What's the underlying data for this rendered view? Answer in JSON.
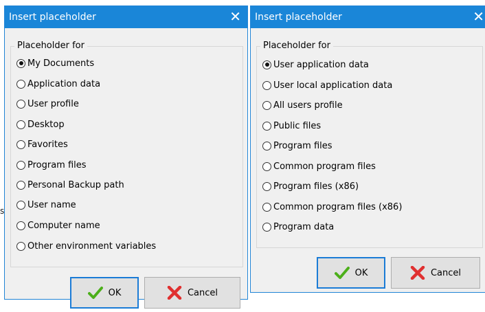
{
  "stray_text": "s",
  "dialog_a": {
    "title": "Insert placeholder",
    "close_glyph": "✕",
    "group_label": "Placeholder for",
    "options": [
      {
        "label": "My Documents",
        "checked": true
      },
      {
        "label": "Application data",
        "checked": false
      },
      {
        "label": "User profile",
        "checked": false
      },
      {
        "label": "Desktop",
        "checked": false
      },
      {
        "label": "Favorites",
        "checked": false
      },
      {
        "label": "Program files",
        "checked": false
      },
      {
        "label": "Personal Backup path",
        "checked": false
      },
      {
        "label": "User name",
        "checked": false
      },
      {
        "label": "Computer name",
        "checked": false
      },
      {
        "label": "Other environment variables",
        "checked": false
      }
    ],
    "ok_label": "OK",
    "cancel_label": "Cancel"
  },
  "dialog_b": {
    "title": "Insert placeholder",
    "close_glyph": "✕",
    "group_label": "Placeholder for",
    "options": [
      {
        "label": "User application data",
        "checked": true
      },
      {
        "label": "User local application data",
        "checked": false
      },
      {
        "label": "All users profile",
        "checked": false
      },
      {
        "label": "Public files",
        "checked": false
      },
      {
        "label": "Program files",
        "checked": false
      },
      {
        "label": "Common program files",
        "checked": false
      },
      {
        "label": "Program files (x86)",
        "checked": false
      },
      {
        "label": "Common program files (x86)",
        "checked": false
      },
      {
        "label": "Program data",
        "checked": false
      }
    ],
    "ok_label": "OK",
    "cancel_label": "Cancel"
  },
  "colors": {
    "titlebar": "#1a86d8",
    "dialog_bg": "#f0f0f0",
    "ok_check": "#4caf1a",
    "cancel_x": "#e03030"
  },
  "icons": {
    "ok": "checkmark-icon",
    "cancel": "red-x-icon"
  }
}
